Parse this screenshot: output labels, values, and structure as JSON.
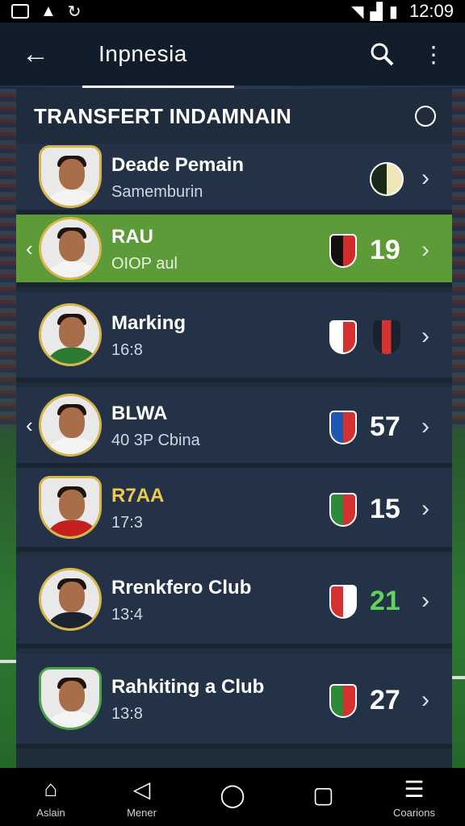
{
  "status_bar": {
    "time": "12:09"
  },
  "app_bar": {
    "title": "Inpnesia"
  },
  "panel": {
    "title": "TRANSFERT INDAMNAIN",
    "rows": [
      {
        "name": "Deade Pemain",
        "sub": "Samemburin",
        "number": "",
        "highlight": false,
        "has_prev": false,
        "badge_colors": [
          "#1a2a1a",
          "#f1e6b8"
        ]
      },
      {
        "name": "RAU",
        "sub": "OIOP aul",
        "number": "19",
        "number_color": "#ffffff",
        "highlight": true,
        "has_prev": true,
        "badge_colors": [
          "#111111",
          "#d22b2b"
        ]
      },
      {
        "name": "Marking",
        "sub": "16:8",
        "number": "",
        "highlight": false,
        "has_prev": false,
        "badge_colors": [
          "#ffffff",
          "#d63131"
        ]
      },
      {
        "name": "BLWA",
        "sub": "40 3P Cbina",
        "number": "57",
        "number_color": "#ffffff",
        "highlight": false,
        "has_prev": true,
        "badge_colors": [
          "#1f57b5",
          "#d63131"
        ]
      },
      {
        "name": "R7AA",
        "sub": "17:3",
        "number": "15",
        "number_color": "#ffffff",
        "highlight": false,
        "has_prev": false,
        "badge_colors": [
          "#2d8a39",
          "#d63131"
        ]
      },
      {
        "name": "Rrenkfero Club",
        "sub": "13:4",
        "number": "21",
        "number_color": "#5fd35a",
        "highlight": false,
        "has_prev": false,
        "badge_colors": [
          "#d63131",
          "#ffffff"
        ]
      },
      {
        "name": "Rahkiting a Club",
        "sub": "13:8",
        "number": "27",
        "number_color": "#ffffff",
        "highlight": false,
        "has_prev": false,
        "badge_colors": [
          "#2d8a39",
          "#d63131"
        ]
      }
    ]
  },
  "bottom_nav": [
    {
      "label": "Aslain",
      "icon": "home-icon"
    },
    {
      "label": "Mener",
      "icon": "back-triangle-icon"
    },
    {
      "label": "",
      "icon": "chat-icon"
    },
    {
      "label": "",
      "icon": "square-icon"
    },
    {
      "label": "Coarions",
      "icon": "stack-icon"
    }
  ],
  "colors": {
    "highlight": "#5d9a38",
    "appbar": "#121d2b",
    "row": "#243247"
  }
}
